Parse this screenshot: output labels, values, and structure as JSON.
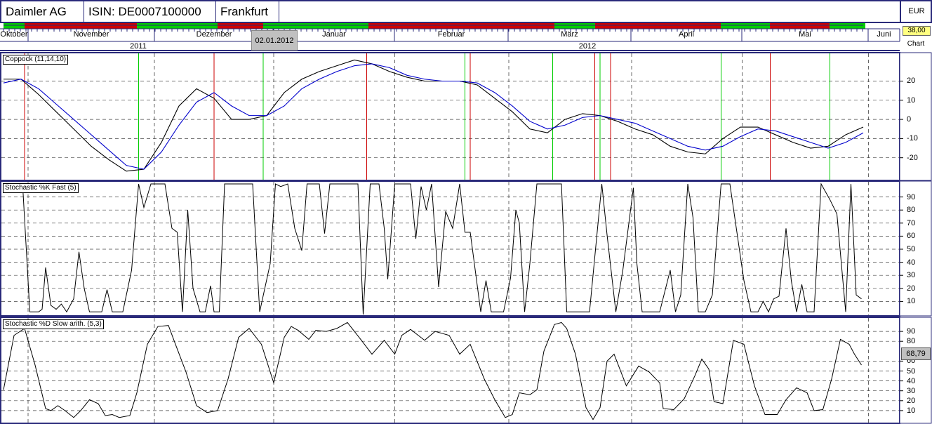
{
  "header": {
    "company": "Daimler AG",
    "isin": "ISIN: DE0007100000",
    "exchange": "Frankfurt",
    "currency": "EUR"
  },
  "timeline": {
    "months": [
      "Oktober",
      "November",
      "Dezember",
      "Januar",
      "Februar",
      "März",
      "April",
      "Mai",
      "Juni"
    ],
    "years": [
      "2011",
      "2012"
    ],
    "selected_date": "02.01.2012",
    "price": "38,00",
    "chart_label": "Chart"
  },
  "colors": {
    "frame": "#2a2a7a",
    "buy": "#00cc00",
    "sell": "#cc0000",
    "main": "#000000",
    "signal": "#0000cc"
  },
  "month_grid_t": [
    1.4,
    8.6,
    15.4,
    22.3,
    28.8,
    35.8,
    42.1,
    49.3
  ],
  "chart_data": [
    {
      "type": "line",
      "title": "Coppock (11,14,10)",
      "ylim": [
        -30,
        33
      ],
      "yticks": [
        20,
        10,
        0,
        -10,
        -20
      ],
      "series": [
        {
          "name": "Coppock",
          "values": [
            21,
            21,
            13,
            4,
            -5,
            -14,
            -21,
            -27,
            -26,
            -12,
            7,
            16,
            11,
            0,
            0,
            2,
            14,
            21,
            25,
            28,
            31,
            29,
            25,
            22,
            20,
            20,
            20,
            18,
            11,
            4,
            -5,
            -7,
            0,
            3,
            2,
            -1,
            -5,
            -8,
            -14,
            -17,
            -18,
            -10,
            -4,
            -4,
            -8,
            -12,
            -15,
            -14,
            -8,
            -4
          ]
        },
        {
          "name": "Signal",
          "values": [
            19,
            21,
            16,
            8,
            0,
            -8,
            -16,
            -24,
            -26,
            -17,
            -3,
            9,
            14,
            7,
            2,
            2,
            7,
            16,
            21,
            25,
            28,
            29,
            27,
            23,
            21,
            20,
            20,
            19,
            14,
            7,
            -1,
            -5,
            -3,
            1,
            2,
            0,
            -2,
            -6,
            -10,
            -14,
            -16,
            -14,
            -9,
            -5,
            -6,
            -9,
            -12,
            -15,
            -12,
            -7
          ]
        }
      ],
      "sell_signals_t": [
        1.2,
        12.0,
        20.7,
        26.6,
        33.7,
        34.6,
        43.7
      ],
      "buy_signals_t": [
        7.7,
        14.8,
        26.3,
        31.3,
        34.0,
        40.9,
        47.1
      ]
    },
    {
      "type": "line",
      "title": "Stochastic %K Fast (5)",
      "ylim": [
        0,
        100
      ],
      "yticks": [
        90,
        80,
        70,
        60,
        50,
        40,
        30,
        20,
        10
      ],
      "points": [
        [
          0,
          98
        ],
        [
          1.1,
          97
        ],
        [
          1.5,
          2
        ],
        [
          2,
          2
        ],
        [
          2.2,
          4
        ],
        [
          2.4,
          36
        ],
        [
          2.7,
          7
        ],
        [
          3,
          4
        ],
        [
          3.3,
          8
        ],
        [
          3.6,
          2
        ],
        [
          4,
          12
        ],
        [
          4.3,
          48
        ],
        [
          4.6,
          20
        ],
        [
          4.9,
          2
        ],
        [
          5.6,
          2
        ],
        [
          5.9,
          19
        ],
        [
          6.2,
          2
        ],
        [
          6.8,
          2
        ],
        [
          7.3,
          34
        ],
        [
          7.7,
          100
        ],
        [
          8,
          82
        ],
        [
          8.4,
          100
        ],
        [
          9.2,
          100
        ],
        [
          9.6,
          66
        ],
        [
          9.9,
          63
        ],
        [
          10.2,
          2
        ],
        [
          10.5,
          80
        ],
        [
          10.8,
          20
        ],
        [
          11.2,
          2
        ],
        [
          11.5,
          2
        ],
        [
          11.8,
          22
        ],
        [
          12,
          2
        ],
        [
          12.3,
          2
        ],
        [
          12.6,
          100
        ],
        [
          14.2,
          100
        ],
        [
          14.6,
          2
        ],
        [
          15.2,
          39
        ],
        [
          15.5,
          100
        ],
        [
          15.8,
          98
        ],
        [
          16.2,
          100
        ],
        [
          16.6,
          66
        ],
        [
          17,
          49
        ],
        [
          17.3,
          100
        ],
        [
          18,
          100
        ],
        [
          18.3,
          62
        ],
        [
          18.6,
          100
        ],
        [
          20.2,
          100
        ],
        [
          20.5,
          0
        ],
        [
          20.9,
          100
        ],
        [
          21.4,
          100
        ],
        [
          21.7,
          66
        ],
        [
          21.9,
          27
        ],
        [
          22.3,
          100
        ],
        [
          23.2,
          100
        ],
        [
          23.5,
          58
        ],
        [
          23.8,
          98
        ],
        [
          24.1,
          80
        ],
        [
          24.4,
          100
        ],
        [
          24.8,
          21
        ],
        [
          25.2,
          79
        ],
        [
          25.6,
          66
        ],
        [
          26,
          100
        ],
        [
          26.3,
          63
        ],
        [
          26.6,
          63
        ],
        [
          27.2,
          2
        ],
        [
          27.5,
          26
        ],
        [
          27.8,
          2
        ],
        [
          28.5,
          2
        ],
        [
          28.9,
          28
        ],
        [
          29.2,
          80
        ],
        [
          29.4,
          70
        ],
        [
          29.7,
          2
        ],
        [
          30,
          39
        ],
        [
          30.4,
          100
        ],
        [
          31.8,
          100
        ],
        [
          32.1,
          2
        ],
        [
          33.4,
          2
        ],
        [
          34.1,
          100
        ],
        [
          34.4,
          61
        ],
        [
          34.9,
          2
        ],
        [
          35.3,
          34
        ],
        [
          35.9,
          97
        ],
        [
          36.1,
          39
        ],
        [
          36.4,
          2
        ],
        [
          37.4,
          2
        ],
        [
          38,
          34
        ],
        [
          38.3,
          2
        ],
        [
          38.6,
          15
        ],
        [
          39,
          100
        ],
        [
          39.3,
          74
        ],
        [
          39.6,
          2
        ],
        [
          40,
          2
        ],
        [
          40.4,
          15
        ],
        [
          40.9,
          100
        ],
        [
          41.4,
          100
        ],
        [
          41.8,
          63
        ],
        [
          42.2,
          26
        ],
        [
          42.6,
          2
        ],
        [
          43,
          2
        ],
        [
          43.3,
          10
        ],
        [
          43.6,
          2
        ],
        [
          43.9,
          12
        ],
        [
          44.2,
          14
        ],
        [
          44.6,
          66
        ],
        [
          44.9,
          26
        ],
        [
          45.2,
          2
        ],
        [
          45.5,
          23
        ],
        [
          45.8,
          2
        ],
        [
          46.2,
          2
        ],
        [
          46.6,
          100
        ],
        [
          47.1,
          88
        ],
        [
          47.5,
          77
        ],
        [
          48,
          2
        ],
        [
          48.3,
          100
        ],
        [
          48.6,
          15
        ],
        [
          48.9,
          12
        ]
      ]
    },
    {
      "type": "line",
      "title": "Stochastic %D Slow arith. (5,3)",
      "ylim": [
        0,
        100
      ],
      "yticks": [
        90,
        80,
        60,
        50,
        40,
        30,
        20,
        10
      ],
      "last_value": "68,79",
      "points": [
        [
          0,
          31
        ],
        [
          0.6,
          86
        ],
        [
          1.2,
          93
        ],
        [
          1.8,
          56
        ],
        [
          2.4,
          12
        ],
        [
          2.7,
          10
        ],
        [
          3.1,
          15
        ],
        [
          3.5,
          10
        ],
        [
          4,
          3
        ],
        [
          4.4,
          10
        ],
        [
          4.9,
          21
        ],
        [
          5.4,
          17
        ],
        [
          5.8,
          5
        ],
        [
          6.2,
          6
        ],
        [
          6.6,
          3
        ],
        [
          7.2,
          5
        ],
        [
          7.6,
          28
        ],
        [
          8.2,
          77
        ],
        [
          8.8,
          95
        ],
        [
          9.4,
          96
        ],
        [
          9.8,
          77
        ],
        [
          10.4,
          49
        ],
        [
          11,
          15
        ],
        [
          11.6,
          8
        ],
        [
          12.2,
          10
        ],
        [
          12.8,
          42
        ],
        [
          13.4,
          84
        ],
        [
          14,
          93
        ],
        [
          14.7,
          77
        ],
        [
          15.4,
          38
        ],
        [
          16,
          84
        ],
        [
          16.4,
          95
        ],
        [
          16.8,
          91
        ],
        [
          17.4,
          82
        ],
        [
          17.8,
          91
        ],
        [
          18.4,
          90
        ],
        [
          19,
          93
        ],
        [
          19.6,
          99
        ],
        [
          20.4,
          81
        ],
        [
          21,
          67
        ],
        [
          21.7,
          81
        ],
        [
          22.3,
          67
        ],
        [
          22.7,
          86
        ],
        [
          23.2,
          92
        ],
        [
          24,
          81
        ],
        [
          24.6,
          90
        ],
        [
          25,
          88
        ],
        [
          25.4,
          86
        ],
        [
          26,
          67
        ],
        [
          26.6,
          77
        ],
        [
          27.4,
          42
        ],
        [
          28,
          21
        ],
        [
          28.6,
          3
        ],
        [
          29,
          6
        ],
        [
          29.4,
          28
        ],
        [
          30,
          26
        ],
        [
          30.4,
          31
        ],
        [
          30.8,
          70
        ],
        [
          31.4,
          97
        ],
        [
          31.8,
          99
        ],
        [
          32.1,
          93
        ],
        [
          32.6,
          67
        ],
        [
          33.2,
          13
        ],
        [
          33.6,
          1
        ],
        [
          34,
          13
        ],
        [
          34.4,
          60
        ],
        [
          34.8,
          67
        ],
        [
          35.5,
          35
        ],
        [
          36.2,
          55
        ],
        [
          36.8,
          49
        ],
        [
          37.4,
          38
        ],
        [
          37.6,
          12
        ],
        [
          38.2,
          11
        ],
        [
          38.8,
          22
        ],
        [
          39.4,
          45
        ],
        [
          39.8,
          62
        ],
        [
          40.2,
          52
        ],
        [
          40.5,
          19
        ],
        [
          41,
          17
        ],
        [
          41.6,
          81
        ],
        [
          42.2,
          77
        ],
        [
          42.8,
          35
        ],
        [
          43.4,
          6
        ],
        [
          44.1,
          6
        ],
        [
          44.6,
          21
        ],
        [
          45.2,
          33
        ],
        [
          45.8,
          28
        ],
        [
          46.2,
          10
        ],
        [
          46.7,
          11
        ],
        [
          47.2,
          42
        ],
        [
          47.7,
          82
        ],
        [
          48.2,
          77
        ],
        [
          48.5,
          67
        ],
        [
          48.9,
          56
        ]
      ]
    }
  ]
}
